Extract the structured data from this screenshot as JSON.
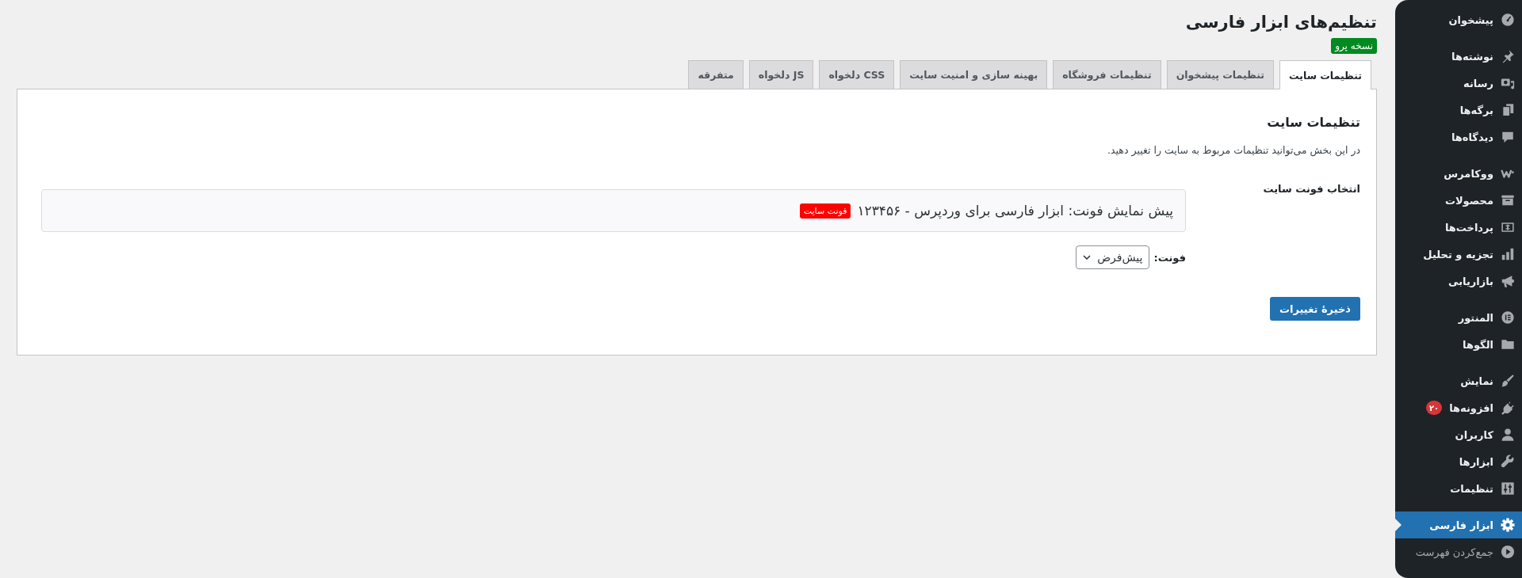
{
  "page": {
    "title": "تنظیم‌های ابزار فارسی",
    "badge": "نسخه پرو"
  },
  "tabs": [
    {
      "label": "تنظیمات سایت",
      "selected": true
    },
    {
      "label": "تنظیمات پیشخوان",
      "selected": false
    },
    {
      "label": "تنظیمات فروشگاه",
      "selected": false
    },
    {
      "label": "بهینه سازی و امنیت سایت",
      "selected": false
    },
    {
      "label": "CSS دلخواه",
      "selected": false
    },
    {
      "label": "JS دلخواه",
      "selected": false
    },
    {
      "label": "متفرقه",
      "selected": false
    }
  ],
  "panel": {
    "heading": "تنظیمات سایت",
    "description": "در این بخش می‌توانید تنظیمات مربوط به سایت را تغییر دهید.",
    "font_setting": {
      "label": "انتخاب فونت سایت",
      "preview_text": "پیش نمایش فونت: ابزار فارسی برای وردپرس - ۱۲۳۴۵۶",
      "preview_badge": "فونت سایت",
      "select_label": "فونت:",
      "select_value": "پیش‌فرض"
    },
    "save_button": "ذخیرهٔ تغییرات"
  },
  "sidebar": {
    "groups": [
      {
        "items": [
          {
            "label": "پیشخوان",
            "selected": false
          }
        ]
      },
      {
        "items": [
          {
            "label": "نوشته‌ها",
            "selected": false
          },
          {
            "label": "رسانه",
            "selected": false
          },
          {
            "label": "برگه‌ها",
            "selected": false
          },
          {
            "label": "دیدگاه‌ها",
            "selected": false
          }
        ]
      },
      {
        "items": [
          {
            "label": "ووکامرس",
            "selected": false
          },
          {
            "label": "محصولات",
            "selected": false
          },
          {
            "label": "پرداخت‌ها",
            "selected": false
          },
          {
            "label": "تجزیه و تحلیل",
            "selected": false
          },
          {
            "label": "بازاریابی",
            "selected": false
          }
        ]
      },
      {
        "items": [
          {
            "label": "المنتور",
            "selected": false
          },
          {
            "label": "الگوها",
            "selected": false
          }
        ]
      },
      {
        "items": [
          {
            "label": "نمایش",
            "selected": false
          },
          {
            "label": "افزونه‌ها",
            "selected": false,
            "count": "۲۰"
          },
          {
            "label": "کاربران",
            "selected": false
          },
          {
            "label": "ابزارها",
            "selected": false
          },
          {
            "label": "تنظیمات",
            "selected": false
          }
        ]
      },
      {
        "items": [
          {
            "label": "ابزار فارسی",
            "selected": true
          }
        ]
      }
    ],
    "collapse": "جمع‌کردن فهرست"
  }
}
